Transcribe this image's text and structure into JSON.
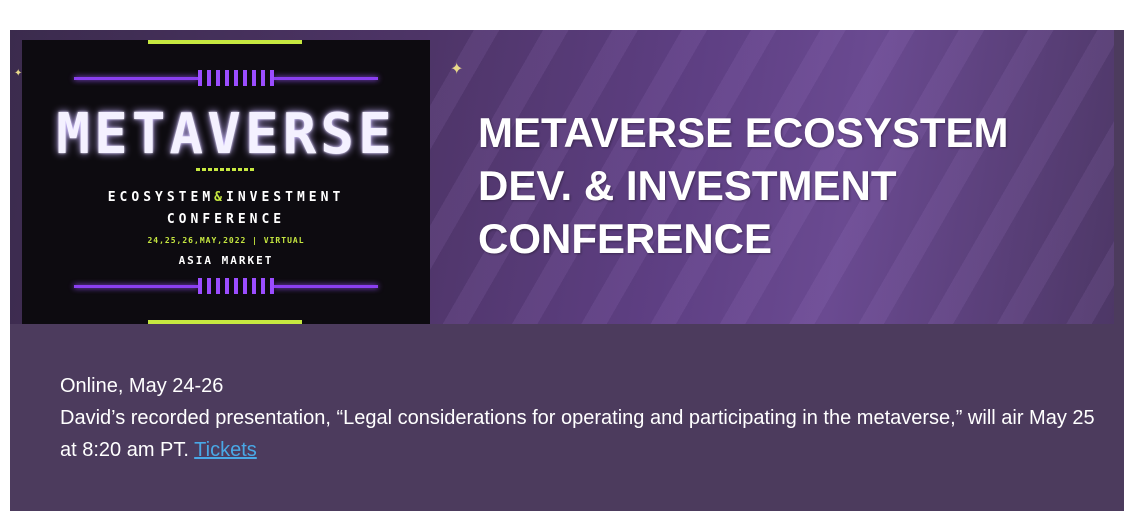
{
  "poster": {
    "title": "METAVERSE",
    "line1_left": "ECOSYSTEM",
    "line1_amp": "&",
    "line1_right": "INVESTMENT",
    "line2": "CONFERENCE",
    "line3": "24,25,26,MAY,2022 | VIRTUAL",
    "line4": "ASIA MARKET"
  },
  "banner": {
    "title_lines": [
      "METAVERSE ECOSYSTEM",
      "DEV. &  INVESTMENT",
      "CONFERENCE"
    ]
  },
  "event": {
    "location_date": "Online, May 24-26",
    "description": "David’s recorded presentation, “Legal considerations for operating and participating in the metaverse,” will air May 25 at 8:20 am PT.",
    "tickets_link": "Tickets"
  },
  "colors": {
    "card_background": "#4c3b5d",
    "link": "#49a8e6",
    "neon_purple": "#8a3ff0",
    "neon_lime": "#c6e840"
  }
}
